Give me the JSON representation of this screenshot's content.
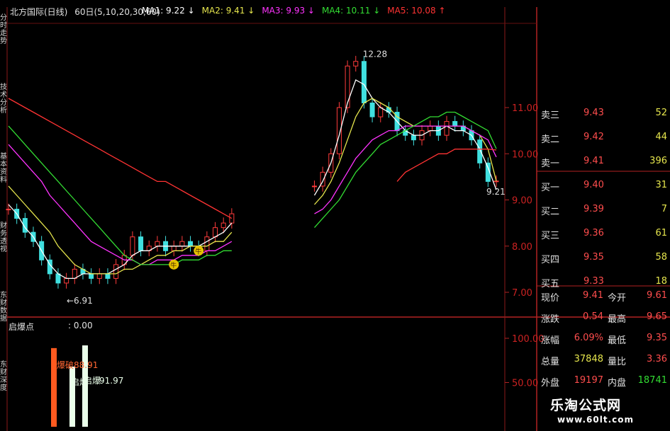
{
  "header": {
    "title": "北方国际(日线)",
    "params": "60日(5,10,20,30,60)",
    "ma": [
      {
        "label": "MA1:",
        "value": "9.22",
        "arrow": "↓",
        "color": "#ffffff"
      },
      {
        "label": "MA2:",
        "value": "9.41",
        "arrow": "↓",
        "color": "#e6e64d"
      },
      {
        "label": "MA3:",
        "value": "9.93",
        "arrow": "↓",
        "color": "#ff33ff"
      },
      {
        "label": "MA4:",
        "value": "10.11",
        "arrow": "↓",
        "color": "#33dd33"
      },
      {
        "label": "MA5:",
        "value": "10.08",
        "arrow": "↑",
        "color": "#ff3333"
      }
    ]
  },
  "side_tabs": [
    "分时走势",
    "技术分析",
    "基本资料",
    "财务透视",
    "东财数据",
    "东财深度"
  ],
  "price_chart": {
    "y_ticks": [
      "11.00",
      "10.00",
      "9.00",
      "8.00",
      "7.00"
    ],
    "annotations": {
      "high": "12.28",
      "low": "6.91",
      "last": "9.21"
    },
    "markers": [
      "牛",
      "牛"
    ]
  },
  "indicator": {
    "name": "启爆点",
    "value": ": 0.00",
    "y_ticks": [
      "100.00",
      "50.00"
    ],
    "labels": [
      {
        "text": "爆破88.91",
        "color": "#ff6633"
      },
      {
        "text": "启爆",
        "color": "#eaffea"
      },
      {
        "text": "启爆",
        "color": "#eaffea"
      },
      {
        "text": "91.97",
        "color": "#eaffea"
      }
    ]
  },
  "quote": {
    "sell": [
      {
        "label": "卖三",
        "price": "9.43",
        "vol": "52"
      },
      {
        "label": "卖二",
        "price": "9.42",
        "vol": "44"
      },
      {
        "label": "卖一",
        "price": "9.41",
        "vol": "396"
      }
    ],
    "buy": [
      {
        "label": "买一",
        "price": "9.40",
        "vol": "31"
      },
      {
        "label": "买二",
        "price": "9.39",
        "vol": "7"
      },
      {
        "label": "买三",
        "price": "9.36",
        "vol": "61"
      },
      {
        "label": "买四",
        "price": "9.35",
        "vol": "58"
      },
      {
        "label": "买五",
        "price": "9.33",
        "vol": "18"
      }
    ],
    "stats": [
      {
        "l1": "现价",
        "v1": "9.41",
        "c1": "#ff4d4d",
        "l2": "今开",
        "v2": "9.61",
        "c2": "#ff4d4d"
      },
      {
        "l1": "涨跌",
        "v1": "0.54",
        "c1": "#ff4d4d",
        "l2": "最高",
        "v2": "9.65",
        "c2": "#ff4d4d"
      },
      {
        "l1": "涨幅",
        "v1": "6.09%",
        "c1": "#ff4d4d",
        "l2": "最低",
        "v2": "9.35",
        "c2": "#ff4d4d"
      },
      {
        "l1": "总量",
        "v1": "37848",
        "c1": "#e6e64d",
        "l2": "量比",
        "v2": "3.36",
        "c2": "#ff4d4d"
      },
      {
        "l1": "外盘",
        "v1": "19197",
        "c1": "#ff4d4d",
        "l2": "内盘",
        "v2": "18741",
        "c2": "#33dd33"
      }
    ]
  },
  "watermark": {
    "title": "乐淘公式网",
    "url": "www.60lt.com"
  },
  "chart_data": [
    {
      "type": "line",
      "y_axis": [
        7.0,
        11.0
      ],
      "x": [
        1,
        2,
        3,
        4,
        5,
        6,
        7,
        8,
        9,
        10,
        11,
        12,
        13,
        14,
        15,
        16,
        17,
        18,
        19,
        20,
        21,
        22,
        23,
        24,
        25,
        26,
        27,
        28,
        29,
        30,
        31,
        32,
        33,
        34,
        35,
        36,
        37,
        38,
        39,
        40,
        41,
        42,
        43,
        44,
        45,
        46,
        47,
        48,
        49,
        50,
        51,
        52,
        53,
        54,
        55,
        56,
        57,
        58,
        59,
        60
      ],
      "close": [
        8.8,
        8.6,
        8.3,
        8.1,
        7.7,
        7.4,
        7.2,
        7.3,
        7.5,
        7.4,
        7.3,
        7.4,
        7.3,
        7.6,
        7.8,
        8.2,
        7.9,
        8.0,
        8.1,
        7.9,
        8.0,
        8.1,
        8.0,
        7.9,
        8.2,
        8.4,
        8.5,
        8.7,
        null,
        null,
        null,
        null,
        null,
        null,
        null,
        null,
        null,
        9.3,
        9.6,
        10.0,
        11.0,
        11.9,
        12.0,
        11.1,
        10.8,
        11.0,
        10.9,
        10.5,
        10.4,
        10.3,
        10.5,
        10.6,
        10.4,
        10.7,
        10.6,
        10.5,
        10.3,
        9.8,
        9.4,
        9.41
      ],
      "high_label": 12.28,
      "low_label": 6.91,
      "last_label": 9.21,
      "series": [
        {
          "name": "MA1",
          "values": [
            8.9,
            8.7,
            8.4,
            8.2,
            7.9,
            7.6,
            7.4,
            7.3,
            7.3,
            7.4,
            7.4,
            7.4,
            7.4,
            7.5,
            7.6,
            7.8,
            7.9,
            7.9,
            8.0,
            8.0,
            8.0,
            8.0,
            8.0,
            8.0,
            8.1,
            8.2,
            8.3,
            8.5,
            null,
            null,
            null,
            null,
            null,
            null,
            null,
            null,
            null,
            9.1,
            9.4,
            9.8,
            10.4,
            11.1,
            11.6,
            11.5,
            11.2,
            11.0,
            10.9,
            10.7,
            10.5,
            10.4,
            10.4,
            10.5,
            10.5,
            10.6,
            10.5,
            10.5,
            10.4,
            10.1,
            9.7,
            9.22
          ]
        },
        {
          "name": "MA2",
          "values": [
            9.3,
            9.1,
            8.9,
            8.7,
            8.5,
            8.3,
            8.0,
            7.8,
            7.6,
            7.5,
            7.4,
            7.4,
            7.4,
            7.4,
            7.5,
            7.5,
            7.6,
            7.7,
            7.8,
            7.8,
            7.9,
            7.9,
            8.0,
            8.0,
            8.0,
            8.1,
            8.1,
            8.3,
            null,
            null,
            null,
            null,
            null,
            null,
            null,
            null,
            null,
            8.9,
            9.1,
            9.4,
            9.8,
            10.3,
            10.8,
            11.1,
            11.2,
            11.1,
            11.0,
            10.8,
            10.7,
            10.6,
            10.6,
            10.6,
            10.6,
            10.6,
            10.6,
            10.6,
            10.5,
            10.4,
            10.1,
            9.41
          ]
        },
        {
          "name": "MA3",
          "values": [
            10.2,
            10.0,
            9.8,
            9.6,
            9.4,
            9.1,
            8.9,
            8.7,
            8.5,
            8.3,
            8.1,
            8.0,
            7.9,
            7.8,
            7.7,
            7.7,
            7.6,
            7.6,
            7.7,
            7.7,
            7.7,
            7.8,
            7.8,
            7.8,
            7.9,
            7.9,
            8.0,
            8.1,
            null,
            null,
            null,
            null,
            null,
            null,
            null,
            null,
            null,
            8.7,
            8.8,
            9.0,
            9.3,
            9.6,
            9.9,
            10.1,
            10.3,
            10.4,
            10.5,
            10.5,
            10.6,
            10.6,
            10.6,
            10.6,
            10.6,
            10.6,
            10.6,
            10.6,
            10.5,
            10.4,
            10.3,
            9.93
          ]
        },
        {
          "name": "MA4",
          "values": [
            10.6,
            10.4,
            10.2,
            10.0,
            9.8,
            9.6,
            9.4,
            9.2,
            9.0,
            8.8,
            8.6,
            8.4,
            8.2,
            8.0,
            7.8,
            7.7,
            7.6,
            7.6,
            7.6,
            7.6,
            7.6,
            7.7,
            7.7,
            7.7,
            7.8,
            7.8,
            7.9,
            7.9,
            null,
            null,
            null,
            null,
            null,
            null,
            null,
            null,
            null,
            8.4,
            8.6,
            8.8,
            9.0,
            9.3,
            9.6,
            9.8,
            10.0,
            10.2,
            10.3,
            10.4,
            10.5,
            10.6,
            10.7,
            10.8,
            10.8,
            10.9,
            10.9,
            10.8,
            10.7,
            10.6,
            10.5,
            10.11
          ]
        },
        {
          "name": "MA5",
          "values": [
            11.2,
            11.1,
            11.0,
            10.9,
            10.8,
            10.7,
            10.6,
            10.5,
            10.4,
            10.3,
            10.2,
            10.1,
            10.0,
            9.9,
            9.8,
            9.7,
            9.6,
            9.5,
            9.4,
            9.4,
            9.3,
            9.2,
            9.1,
            9.0,
            8.9,
            8.8,
            8.7,
            8.6,
            null,
            null,
            null,
            null,
            null,
            null,
            null,
            null,
            null,
            null,
            null,
            null,
            null,
            null,
            null,
            null,
            null,
            null,
            null,
            9.4,
            9.6,
            9.7,
            9.8,
            9.9,
            10.0,
            10.0,
            10.1,
            10.1,
            10.1,
            10.1,
            10.1,
            10.08
          ]
        }
      ]
    },
    {
      "type": "bar",
      "y_axis": [
        0,
        100
      ],
      "series": [
        {
          "name": "爆破",
          "values": [
            88.91
          ]
        },
        {
          "name": "启爆",
          "values": [
            68.0
          ]
        },
        {
          "name": "启爆",
          "values": [
            91.97
          ]
        }
      ]
    }
  ]
}
